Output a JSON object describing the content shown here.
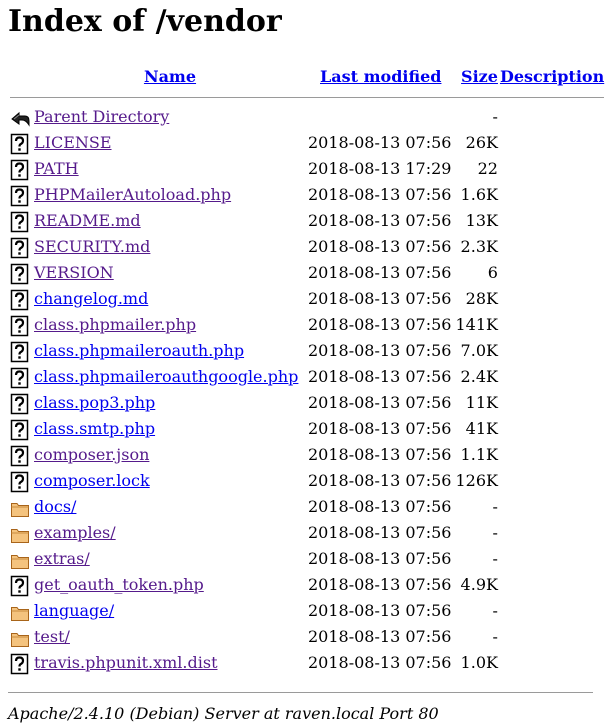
{
  "page": {
    "title": "Index of /vendor"
  },
  "columns": {
    "name": "Name",
    "last_modified": "Last modified",
    "size": "Size",
    "description": "Description"
  },
  "parent": {
    "name": "Parent Directory",
    "date": "",
    "size": "-"
  },
  "rows": [
    {
      "icon": "unknown-file-icon",
      "name": "LICENSE",
      "date": "2018-08-13 07:56",
      "size": "26K",
      "visited": true
    },
    {
      "icon": "unknown-file-icon",
      "name": "PATH",
      "date": "2018-08-13 17:29",
      "size": "22",
      "visited": true
    },
    {
      "icon": "unknown-file-icon",
      "name": "PHPMailerAutoload.php",
      "date": "2018-08-13 07:56",
      "size": "1.6K",
      "visited": true
    },
    {
      "icon": "unknown-file-icon",
      "name": "README.md",
      "date": "2018-08-13 07:56",
      "size": "13K",
      "visited": true
    },
    {
      "icon": "unknown-file-icon",
      "name": "SECURITY.md",
      "date": "2018-08-13 07:56",
      "size": "2.3K",
      "visited": true
    },
    {
      "icon": "unknown-file-icon",
      "name": "VERSION",
      "date": "2018-08-13 07:56",
      "size": "6",
      "visited": true
    },
    {
      "icon": "unknown-file-icon",
      "name": "changelog.md",
      "date": "2018-08-13 07:56",
      "size": "28K",
      "visited": false
    },
    {
      "icon": "unknown-file-icon",
      "name": "class.phpmailer.php",
      "date": "2018-08-13 07:56",
      "size": "141K",
      "visited": true
    },
    {
      "icon": "unknown-file-icon",
      "name": "class.phpmaileroauth.php",
      "date": "2018-08-13 07:56",
      "size": "7.0K",
      "visited": false
    },
    {
      "icon": "unknown-file-icon",
      "name": "class.phpmaileroauthgoogle.php",
      "date": "2018-08-13 07:56",
      "size": "2.4K",
      "visited": false
    },
    {
      "icon": "unknown-file-icon",
      "name": "class.pop3.php",
      "date": "2018-08-13 07:56",
      "size": "11K",
      "visited": false
    },
    {
      "icon": "unknown-file-icon",
      "name": "class.smtp.php",
      "date": "2018-08-13 07:56",
      "size": "41K",
      "visited": false
    },
    {
      "icon": "unknown-file-icon",
      "name": "composer.json",
      "date": "2018-08-13 07:56",
      "size": "1.1K",
      "visited": true
    },
    {
      "icon": "unknown-file-icon",
      "name": "composer.lock",
      "date": "2018-08-13 07:56",
      "size": "126K",
      "visited": false
    },
    {
      "icon": "folder-icon",
      "name": "docs/",
      "date": "2018-08-13 07:56",
      "size": "-",
      "visited": false
    },
    {
      "icon": "folder-icon",
      "name": "examples/",
      "date": "2018-08-13 07:56",
      "size": "-",
      "visited": true
    },
    {
      "icon": "folder-icon",
      "name": "extras/",
      "date": "2018-08-13 07:56",
      "size": "-",
      "visited": true
    },
    {
      "icon": "unknown-file-icon",
      "name": "get_oauth_token.php",
      "date": "2018-08-13 07:56",
      "size": "4.9K",
      "visited": true
    },
    {
      "icon": "folder-icon",
      "name": "language/",
      "date": "2018-08-13 07:56",
      "size": "-",
      "visited": false
    },
    {
      "icon": "folder-icon",
      "name": "test/",
      "date": "2018-08-13 07:56",
      "size": "-",
      "visited": true
    },
    {
      "icon": "unknown-file-icon",
      "name": "travis.phpunit.xml.dist",
      "date": "2018-08-13 07:56",
      "size": "1.0K",
      "visited": true
    }
  ],
  "footer": {
    "address": "Apache/2.4.10 (Debian) Server at raven.local Port 80"
  },
  "colors": {
    "link": "#0000ee",
    "visited": "#551a8b",
    "rule": "#9a9a9a"
  }
}
